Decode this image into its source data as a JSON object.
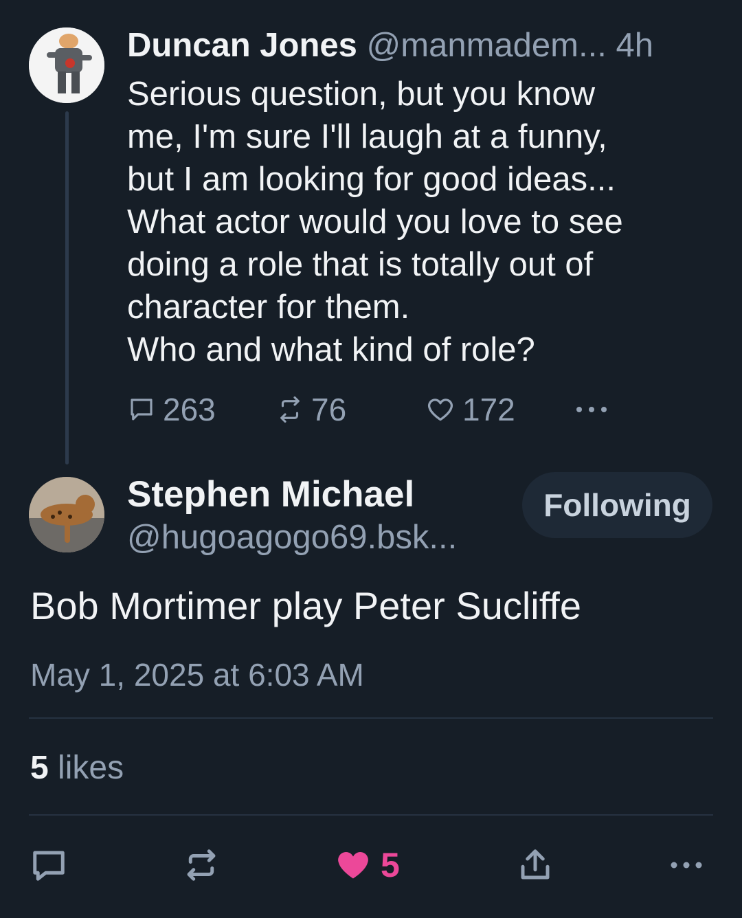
{
  "parent_post": {
    "author_name": "Duncan Jones",
    "handle": "@manmadem...",
    "time": "4h",
    "text": "Serious question, but you know\nme, I'm sure I'll laugh at a funny,\nbut I am looking for good ideas...\nWhat actor would you love to see\ndoing a role that is totally out of\ncharacter for them.\nWho and what kind of role?",
    "stats": {
      "replies": "263",
      "reposts": "76",
      "likes": "172"
    }
  },
  "reply_post": {
    "author_name": "Stephen Michael",
    "handle": "@hugoagogo69.bsk...",
    "follow_label": "Following",
    "text": "Bob Mortimer play Peter Sucliffe",
    "timestamp": "May 1, 2025 at 6:03 AM",
    "likes_count": "5",
    "likes_label": "likes"
  },
  "action_bar": {
    "like_count": "5"
  },
  "colors": {
    "background": "#161e27",
    "muted_text": "#93a1b3",
    "like_active": "#ec4899",
    "follow_button_bg": "#1e2936"
  }
}
